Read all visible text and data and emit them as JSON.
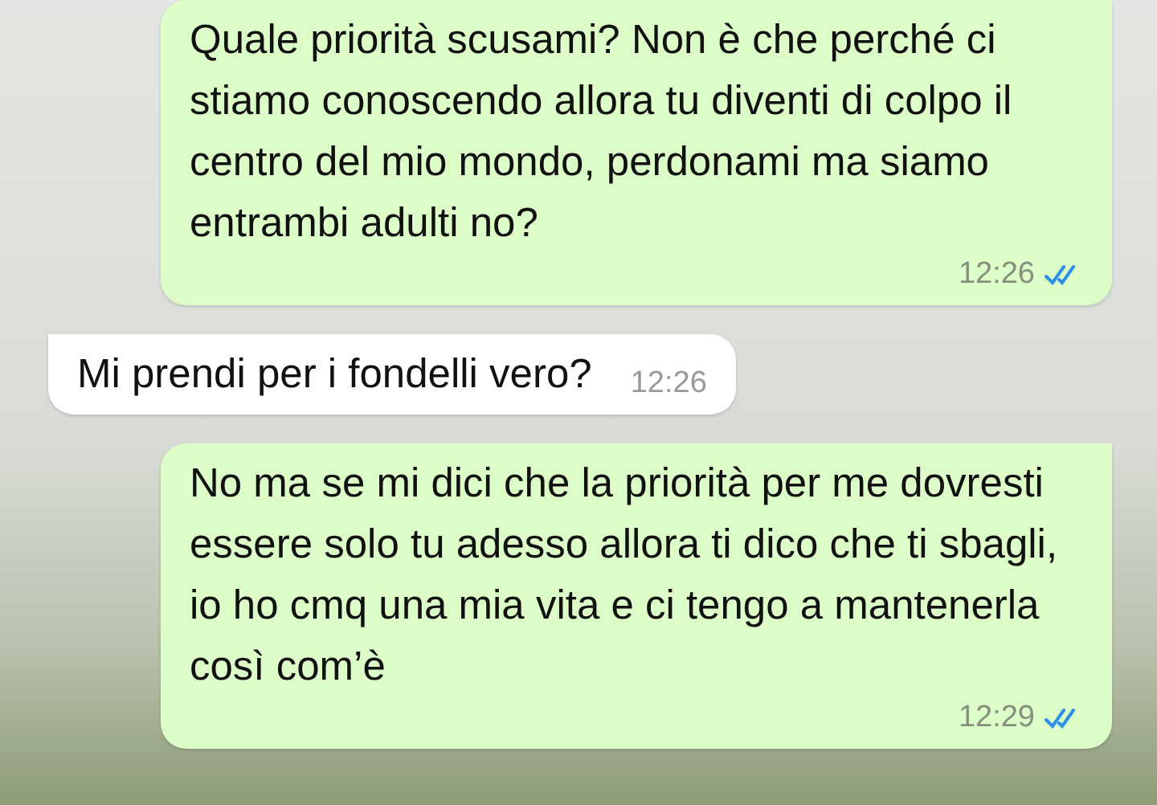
{
  "messages": [
    {
      "kind": "outgoing",
      "text": "Quale priorità scusami? Non è che perché ci stiamo conoscendo allora tu diventi di colpo il centro del mio mondo, perdonami ma siamo entrambi adulti no?",
      "time": "12:26",
      "read": true
    },
    {
      "kind": "incoming",
      "text": "Mi prendi per i fondelli vero?",
      "time": "12:26"
    },
    {
      "kind": "outgoing",
      "text": "No ma se mi dici che la priorità per me dovresti essere solo tu adesso allora ti dico che ti sbagli, io ho cmq una mia vita e ci tengo a mantenerla così com’è",
      "time": "12:29",
      "read": true
    }
  ]
}
